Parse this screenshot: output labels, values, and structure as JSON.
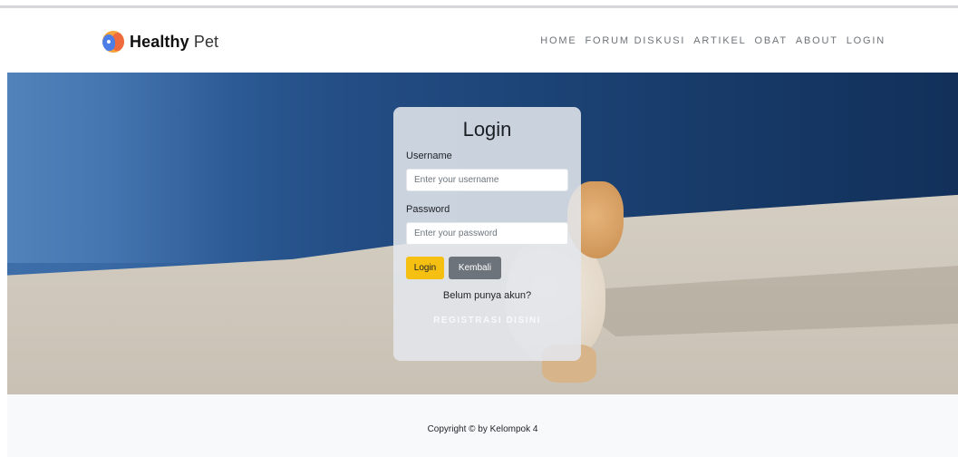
{
  "brand": {
    "name_bold": "Healthy",
    "name_regular": " Pet",
    "logo_icon": "pets-logo-icon"
  },
  "nav": {
    "items": [
      {
        "label": "HOME"
      },
      {
        "label": "FORUM DISKUSI"
      },
      {
        "label": "ARTIKEL"
      },
      {
        "label": "OBAT"
      },
      {
        "label": "ABOUT"
      },
      {
        "label": "LOGIN"
      }
    ]
  },
  "login_card": {
    "title": "Login",
    "username_label": "Username",
    "username_placeholder": "Enter your username",
    "username_value": "",
    "password_label": "Password",
    "password_placeholder": "Enter your password",
    "password_value": "",
    "login_button": "Login",
    "back_button": "Kembali",
    "no_account_text": "Belum punya akun?",
    "register_link": "REGISTRASI DISINI"
  },
  "hero": {
    "image": "puppy-background-photo"
  },
  "footer": {
    "copyright": "Copyright © by Kelompok 4"
  },
  "colors": {
    "login_button": "#f5c012",
    "back_button": "#6c737b",
    "footer_bg": "#f8f9fa",
    "nav_text": "#6f7378"
  }
}
